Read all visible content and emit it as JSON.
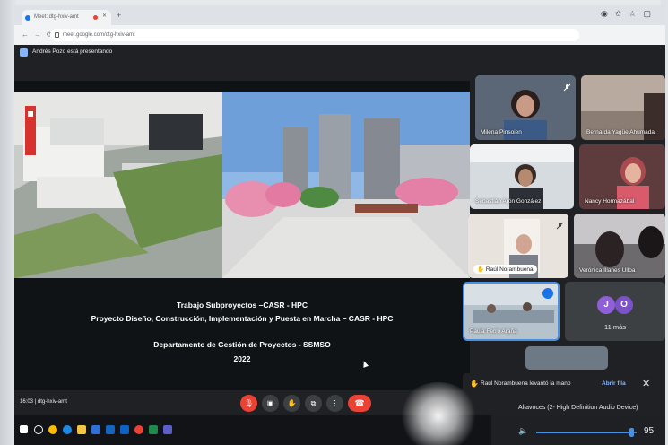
{
  "browser": {
    "tab_title": "Meet: dtg-hxiv-amt",
    "url": "meet.google.com/dtg-hxiv-amt"
  },
  "meet": {
    "presenting_banner": "Andrés Pozo está presentando",
    "meeting_code": "16:03 | dtg-hxiv-amt"
  },
  "slide": {
    "line1": "Trabajo Subproyectos –CASR - HPC",
    "line2": "Proyecto Diseño, Construcción, Implementación y Puesta en Marcha – CASR - HPC",
    "line3": "Departamento de Gestión de Proyectos  - SSMSO",
    "line4": "2022"
  },
  "participants": [
    {
      "name": "Milena Pinsoien"
    },
    {
      "name": "Bernarda Yagüe Ahumada"
    },
    {
      "name": "Sebastián Arón González"
    },
    {
      "name": "Nancy Hormazábal"
    },
    {
      "name": "Raúl Norambuena"
    },
    {
      "name": "Verónica Illanes Ulloa"
    },
    {
      "name": "Paula Ferro Araña"
    }
  ],
  "more_tile": {
    "initial_1": "J",
    "initial_2": "O",
    "label": "11 más"
  },
  "hand_notice": {
    "text": "Raúl Norambuena levantó la mano",
    "open_label": "Abrir fila"
  },
  "volume": {
    "device": "Altavoces (2- High Definition Audio Device)",
    "level": 95
  },
  "colors": {
    "meet_bg": "#202124",
    "end_call": "#ea4335",
    "accent_blue": "#8ab4f8",
    "avatar_purple": "#8e5fd6"
  }
}
